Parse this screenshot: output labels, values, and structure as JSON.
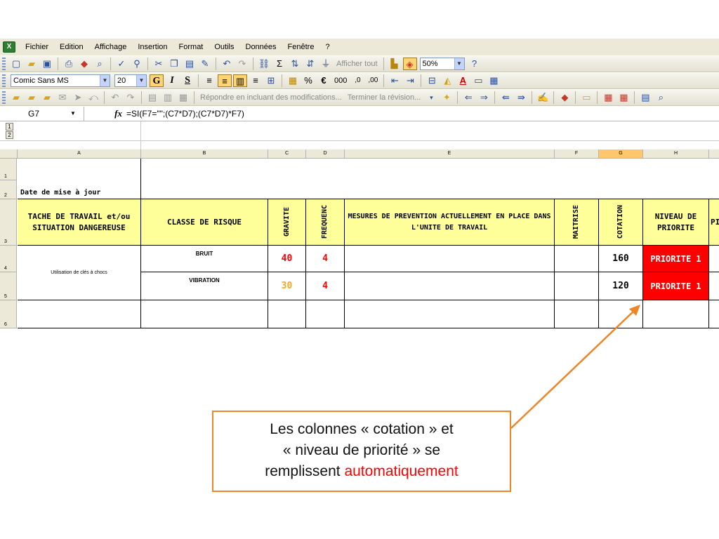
{
  "menu": [
    "Fichier",
    "Edition",
    "Affichage",
    "Insertion",
    "Format",
    "Outils",
    "Données",
    "Fenêtre",
    "?"
  ],
  "toolbar1": {
    "afficher_tout": "Afficher tout",
    "zoom": "50%"
  },
  "toolbar2": {
    "font_name": "Comic Sans MS",
    "font_size": "20",
    "bold": "G",
    "italic": "I",
    "underline": "S",
    "percent": "%",
    "euro": "€",
    "thousands": "000"
  },
  "toolbar3": {
    "reply_changes": "Répondre en incluant des modifications...",
    "end_review": "Terminer la révision..."
  },
  "formula_bar": {
    "name_box": "G7",
    "fx": "fx",
    "formula": "=SI(F7=\"\";(C7*D7);(C7*D7)*F7)"
  },
  "outline_levels": [
    "1",
    "2"
  ],
  "columns": [
    "A",
    "B",
    "C",
    "D",
    "E",
    "F",
    "G",
    "H"
  ],
  "selected_column": "G",
  "rows": [
    "1",
    "2",
    "3",
    "4",
    "5",
    "6"
  ],
  "sheet": {
    "date_label": "Date de mise à jour",
    "headers": {
      "task": "TACHE DE TRAVAIL et/ou SITUATION DANGEREUSE",
      "risk": "CLASSE DE RISQUE",
      "gravite": "GRAVITE",
      "frequence": "FREQUENC",
      "mesures": "MESURES DE PREVENTION ACTUELLEMENT EN PLACE DANS L'UNITE DE TRAVAIL",
      "maitrise": "MAITRISE",
      "cotation": "COTATION",
      "niveau": "NIVEAU DE PRIORITE",
      "next": "PI"
    },
    "task_cell": "Utilisation de clés à chocs",
    "data_rows": [
      {
        "risk": "BRUIT",
        "gravite": "40",
        "frequence": "4",
        "cotation": "160",
        "priorite": "PRIORITE 1"
      },
      {
        "risk": "VIBRATION",
        "gravite": "30",
        "frequence": "4",
        "cotation": "120",
        "priorite": "PRIORITE 1"
      }
    ]
  },
  "callout": {
    "line1": "Les colonnes « cotation » et",
    "line2": "« niveau de priorité » se",
    "line3_prefix": "remplissent ",
    "line3_accent": "automatiquement"
  },
  "colors": {
    "accent_orange": "#ee8527",
    "priority_red": "#ff0000",
    "header_yellow": "#ffff99",
    "gravite_red": "#ff0000",
    "gravite_orange": "#f5a623"
  }
}
